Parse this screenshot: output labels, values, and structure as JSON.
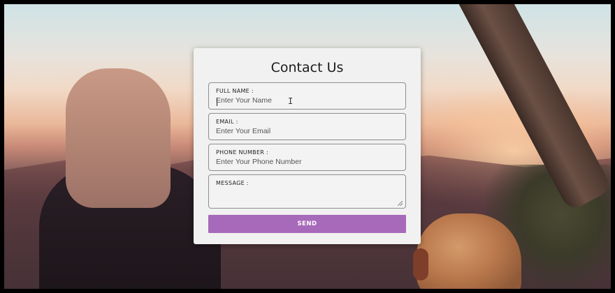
{
  "form": {
    "title": "Contact Us",
    "fields": [
      {
        "label": "FULL NAME :",
        "placeholder": "Enter Your Name",
        "value": ""
      },
      {
        "label": "EMAIL :",
        "placeholder": "Enter Your Email",
        "value": ""
      },
      {
        "label": "PHONE NUMBER :",
        "placeholder": "Enter Your Phone Number",
        "value": ""
      },
      {
        "label": "MESSAGE :",
        "placeholder": "",
        "value": ""
      }
    ],
    "send_label": "SEND",
    "accent_color": "#a769b9",
    "card_background": "#f1f1f1"
  },
  "icons": {
    "cursor": "text-cursor-icon",
    "resize": "resize-grip-icon"
  }
}
